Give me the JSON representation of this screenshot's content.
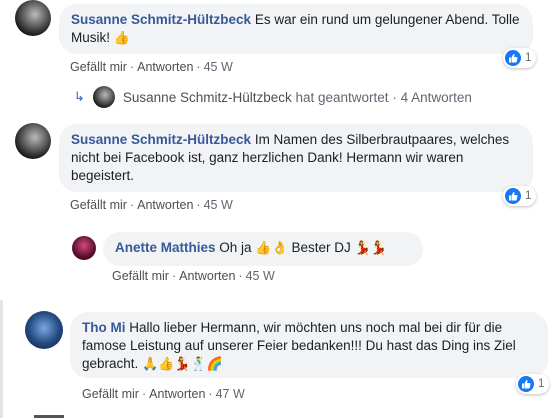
{
  "comments": [
    {
      "author": "Susanne Schmitz-Hültzbeck",
      "text": "Es war ein rund um gelungener Abend. Tolle Musik!",
      "emoji": "👍",
      "like_label": "Gefällt mir",
      "reply_label": "Antworten",
      "age": "45 W",
      "reactions": "1"
    },
    {
      "author": "Susanne Schmitz-Hültzbeck",
      "text": "Im Namen des Silberbrautpaares, welches nicht bei Facebook ist, ganz herzlichen Dank! Hermann wir waren begeistert.",
      "like_label": "Gefällt mir",
      "reply_label": "Antworten",
      "age": "45 W",
      "reactions": "1"
    },
    {
      "author": "Anette Matthies",
      "text_before": "Oh ja",
      "emoji_mid": "👍👌",
      "text_after": "Bester DJ",
      "emoji_end": "💃💃",
      "like_label": "Gefällt mir",
      "reply_label": "Antworten",
      "age": "45 W"
    },
    {
      "author": "Tho Mi",
      "text": "Hallo lieber Hermann, wir möchten uns noch mal bei dir für die famose Leistung auf unserer Feier bedanken!!! Du hast das Ding ins Ziel gebracht.",
      "emoji": "🙏👍💃🕺🌈",
      "like_label": "Gefällt mir",
      "reply_label": "Antworten",
      "age": "47 W",
      "reactions": "1"
    }
  ],
  "reply_summary": {
    "name": "Susanne Schmitz-Hültzbeck",
    "action": "hat geantwortet",
    "count": "4 Antworten"
  },
  "colors": {
    "author_link": "#385898",
    "bubble_bg": "#f2f3f5",
    "like_blue": "#1877f2"
  }
}
